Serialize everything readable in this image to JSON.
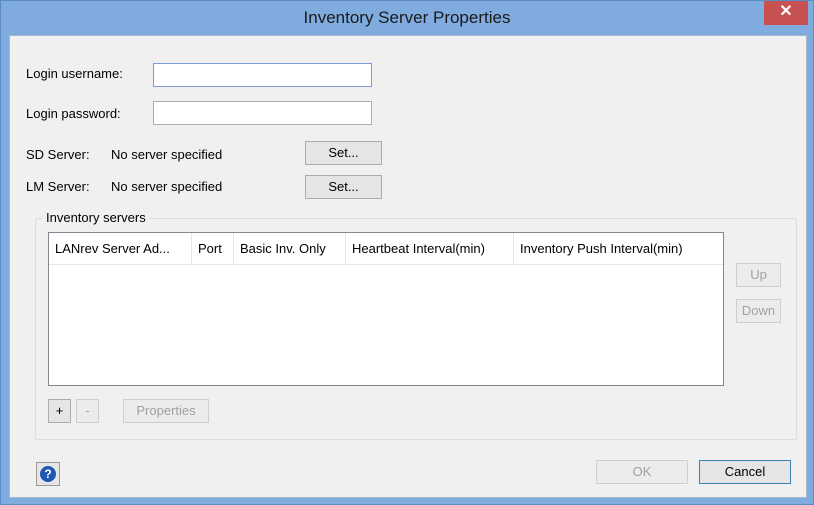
{
  "window": {
    "title": "Inventory Server Properties",
    "close_symbol": "✕"
  },
  "form": {
    "login_username_label": "Login username:",
    "login_username_value": "",
    "login_password_label": "Login password:",
    "login_password_value": "",
    "sd_server_label": "SD Server:",
    "sd_server_value": "No server specified",
    "sd_set_button": "Set...",
    "lm_server_label": "LM Server:",
    "lm_server_value": "No server specified",
    "lm_set_button": "Set..."
  },
  "inventory_servers": {
    "group_title": "Inventory servers",
    "columns": [
      "LANrev Server Ad...",
      "Port",
      "Basic Inv. Only",
      "Heartbeat Interval(min)",
      "Inventory Push Interval(min)"
    ],
    "rows": [],
    "up_button": "Up",
    "down_button": "Down",
    "add_button": "+",
    "remove_button": "-",
    "properties_button": "Properties"
  },
  "footer": {
    "help_icon": "help-icon",
    "help_symbol": "?",
    "ok_button": "OK",
    "cancel_button": "Cancel"
  },
  "colors": {
    "title_bar": "#7fabdf",
    "close_button": "#c75050",
    "dialog_background": "#f0f0f0"
  }
}
